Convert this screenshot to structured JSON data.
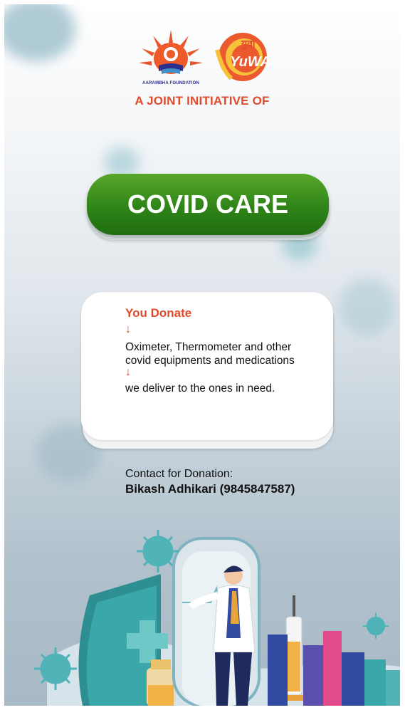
{
  "logos": {
    "aarambha_name": "AARAMBHA FOUNDATION",
    "yuwa_script": "युवा",
    "yuwa_word": "YuWA"
  },
  "header": {
    "initiative": "A JOINT INITIATIVE OF"
  },
  "cta": {
    "label": "COVID CARE"
  },
  "card": {
    "heading": "You Donate",
    "arrow": "↓",
    "step1": "Oximeter, Thermometer and other covid equipments and medications",
    "step2": "we deliver to the ones in need."
  },
  "contact": {
    "label": "Contact for Donation:",
    "name": "Bikash Adhikari (9845847587)"
  },
  "colors": {
    "accent": "#e14b2b",
    "button_green": "#2f8418",
    "virus_teal": "#4fb3b8"
  }
}
